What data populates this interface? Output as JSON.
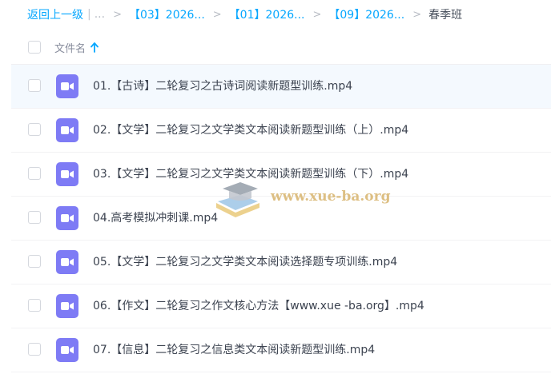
{
  "breadcrumb": {
    "back_label": "返回上一级",
    "pipe": "|",
    "ellipsis": "...",
    "separator": ">",
    "crumbs": [
      "【03】2026...",
      "【01】2026...",
      "【09】2026..."
    ],
    "current": "春季班"
  },
  "header": {
    "name_column": "文件名",
    "sort": "ascending"
  },
  "files": [
    {
      "name": "01.【古诗】二轮复习之古诗词阅读新题型训练.mp4"
    },
    {
      "name": "02.【文学】二轮复习之文学类文本阅读新题型训练（上）.mp4"
    },
    {
      "name": "03.【文学】二轮复习之文学类文本阅读新题型训练（下）.mp4"
    },
    {
      "name": "04.高考模拟冲刺课.mp4"
    },
    {
      "name": "05.【文学】二轮复习之文学类文本阅读选择题专项训练.mp4"
    },
    {
      "name": "06.【作文】二轮复习之作文核心方法【www.xue -ba.org】.mp4"
    },
    {
      "name": "07.【信息】二轮复习之信息类文本阅读新题型训练.mp4"
    }
  ],
  "watermark": {
    "text": "www.xue-ba.org"
  },
  "colors": {
    "accent": "#06a7ff",
    "video_icon": "#7e7bf5",
    "row_highlight": "#f4f9fe"
  },
  "icons": {
    "file_type": "video-file-icon",
    "sort": "arrow-up-icon",
    "watermark_logo": "graduation-cap-book-icon"
  }
}
